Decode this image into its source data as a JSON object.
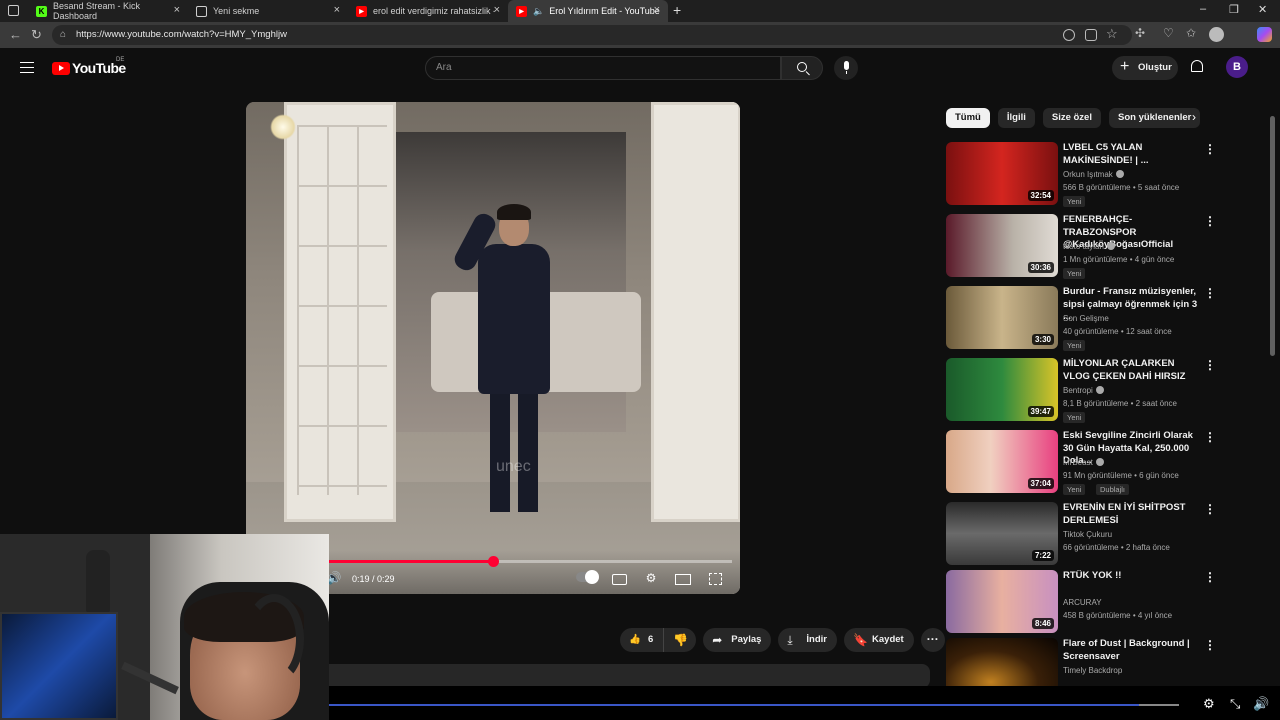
{
  "browser": {
    "tabs": [
      {
        "label": "Besand Stream - Kick Dashboard",
        "color": "#53fc18",
        "glyph": "K"
      },
      {
        "label": "Yeni sekme",
        "color": "#cfcfcf",
        "glyph": "▢"
      },
      {
        "label": "erol edit verdigimiz rahatsizlik - Y",
        "color": "#ff0000",
        "glyph": "▶"
      },
      {
        "label": "Erol Yıldırım Edit - YouTube",
        "color": "#ff0000",
        "glyph": "▶"
      }
    ],
    "url": "https://www.youtube.com/watch?v=HMY_Ymghljw"
  },
  "header": {
    "logo_text": "YouTube",
    "country_code": "DE",
    "search_placeholder": "Ara",
    "create_label": "Oluştur",
    "avatar_letter": "B"
  },
  "player": {
    "watermark": "unec",
    "time_display": "0:19 / 0:29",
    "progress": 0.5
  },
  "actions": {
    "like_count": "6",
    "share_label": "Paylaş",
    "download_label": "İndir",
    "save_label": "Kaydet"
  },
  "chips": [
    "Tümü",
    "İlgili",
    "Size özel",
    "Son yüklenenler"
  ],
  "recommendations": [
    {
      "title": "LVBEL C5 YALAN MAKİNESİNDE! | ...",
      "channel": "Orkun Işıtmak",
      "verified": true,
      "meta": "566 B görüntüleme • 5 saat önce",
      "badge": "Yeni",
      "badge2": "",
      "duration": "32:54",
      "thumb": "linear-gradient(90deg,#7a1010,#d4251f 50%,#7a1010)"
    },
    {
      "title": "FENERBAHÇE-TRABZONSPOR @KadıköyBoğasıOfficial",
      "channel": "testo taylan",
      "verified": true,
      "meta": "1 Mn görüntüleme • 4 gün önce",
      "badge": "Yeni",
      "badge2": "",
      "duration": "30:36",
      "thumb": "linear-gradient(90deg,#5a1a2a,#b9b2a8 60%,#e0dbd4)"
    },
    {
      "title": "Burdur - Fransız müzisyenler, sipsi çalmayı öğrenmek için 3 ...",
      "channel": "Son Gelişme",
      "verified": false,
      "meta": "40 görüntüleme • 12 saat önce",
      "badge": "Yeni",
      "badge2": "",
      "duration": "3:30",
      "thumb": "linear-gradient(90deg,#6b5a3a,#c9b48a 50%,#8a7a5a)"
    },
    {
      "title": "MİLYONLAR ÇALARKEN VLOG ÇEKEN DAHİ HIRSIZ",
      "channel": "Bentropi",
      "verified": true,
      "meta": "8,1 B görüntüleme • 2 saat önce",
      "badge": "Yeni",
      "badge2": "",
      "duration": "39:47",
      "thumb": "linear-gradient(90deg,#1a5a2a,#2e8a3e 50%,#d9c428)"
    },
    {
      "title": "Eski Sevgiline Zincirli Olarak 30 Gün Hayatta Kal, 250.000 Dola...",
      "channel": "MrBeast",
      "verified": true,
      "meta": "91 Mn görüntüleme • 6 gün önce",
      "badge": "Yeni",
      "badge2": "Dublajlı",
      "duration": "37:04",
      "thumb": "linear-gradient(90deg,#d8a888,#f0d0c0 40%,#e84080)"
    },
    {
      "title": "EVRENİN EN İYİ SHİTPOST DERLEMESİ",
      "channel": "Tiktok Çukuru",
      "verified": false,
      "meta": "66 görüntüleme • 2 hafta önce",
      "badge": "",
      "badge2": "",
      "duration": "7:22",
      "thumb": "linear-gradient(180deg,#2a2a2a,#6a6a6a 50%,#3a3a3a)"
    },
    {
      "title": "RTÜK YOK !!",
      "channel": "ARCURAY",
      "verified": false,
      "meta": "458 B görüntüleme • 4 yıl önce",
      "badge": "",
      "badge2": "",
      "duration": "8:46",
      "thumb": "linear-gradient(90deg,#8a6aa0,#e8b0a0 50%,#c890c0)"
    },
    {
      "title": "Flare of Dust | Background | Screensaver",
      "channel": "Timely Backdrop",
      "verified": false,
      "meta": "",
      "badge": "",
      "badge2": "",
      "duration": "",
      "thumb": "radial-gradient(ellipse at 40% 70%,#c08020,#3a2008 50%,#0a0502)"
    }
  ]
}
